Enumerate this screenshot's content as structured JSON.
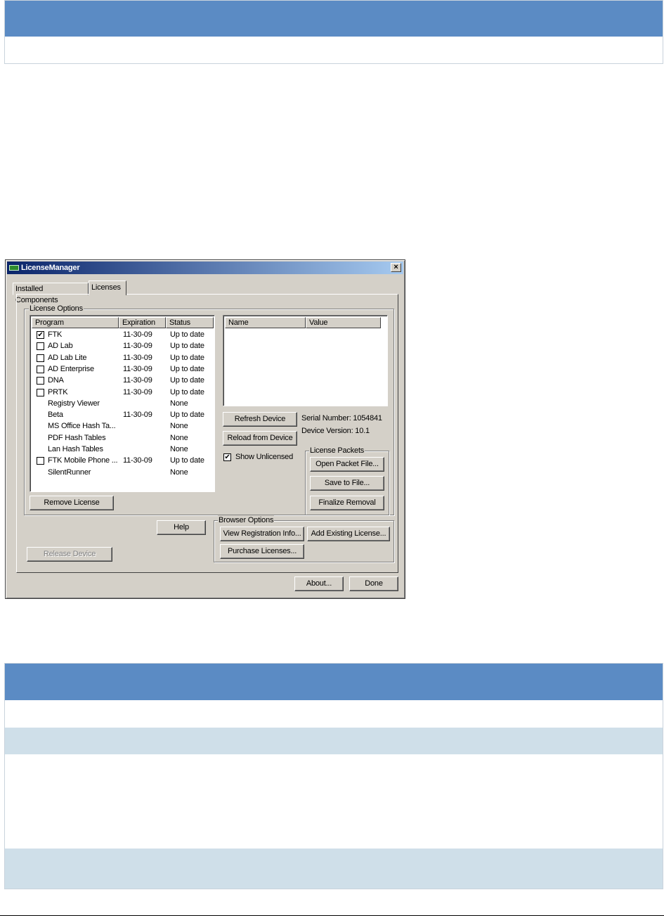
{
  "window": {
    "title": "LicenseManager",
    "close_glyph": "×"
  },
  "tabs": [
    {
      "label": "Installed Components",
      "selected": false
    },
    {
      "label": "Licenses",
      "selected": true
    }
  ],
  "license_options": {
    "group_title": "License Options",
    "columns": [
      "Program",
      "Expiration",
      "Status"
    ],
    "rows": [
      {
        "program": "FTK",
        "expiration": "11-30-09",
        "status": "Up to date",
        "checkbox": true,
        "checked": true
      },
      {
        "program": "AD Lab",
        "expiration": "11-30-09",
        "status": "Up to date",
        "checkbox": true,
        "checked": false
      },
      {
        "program": "AD Lab Lite",
        "expiration": "11-30-09",
        "status": "Up to date",
        "checkbox": true,
        "checked": false
      },
      {
        "program": "AD Enterprise",
        "expiration": "11-30-09",
        "status": "Up to date",
        "checkbox": true,
        "checked": false
      },
      {
        "program": "DNA",
        "expiration": "11-30-09",
        "status": "Up to date",
        "checkbox": true,
        "checked": false
      },
      {
        "program": "PRTK",
        "expiration": "11-30-09",
        "status": "Up to date",
        "checkbox": true,
        "checked": false
      },
      {
        "program": "Registry Viewer",
        "expiration": "",
        "status": "None",
        "checkbox": false,
        "checked": false
      },
      {
        "program": "Beta",
        "expiration": "11-30-09",
        "status": "Up to date",
        "checkbox": false,
        "checked": false
      },
      {
        "program": "MS Office Hash Ta...",
        "expiration": "",
        "status": "None",
        "checkbox": false,
        "checked": false
      },
      {
        "program": "PDF Hash Tables",
        "expiration": "",
        "status": "None",
        "checkbox": false,
        "checked": false
      },
      {
        "program": "Lan Hash Tables",
        "expiration": "",
        "status": "None",
        "checkbox": false,
        "checked": false
      },
      {
        "program": "FTK Mobile Phone ...",
        "expiration": "11-30-09",
        "status": "Up to date",
        "checkbox": true,
        "checked": false
      },
      {
        "program": "SilentRunner",
        "expiration": "",
        "status": "None",
        "checkbox": false,
        "checked": false
      }
    ],
    "remove_license": "Remove License"
  },
  "details": {
    "columns": [
      "Name",
      "Value"
    ],
    "refresh_device": "Refresh Device",
    "reload_from_device": "Reload from Device",
    "serial_number": "Serial Number: 1054841",
    "device_version": "Device Version:  10.1",
    "show_unlicensed": "Show Unlicensed",
    "show_unlicensed_checked": true
  },
  "license_packets": {
    "group_title": "License Packets",
    "open_packet_file": "Open Packet File...",
    "save_to_file": "Save to File...",
    "finalize_removal": "Finalize Removal"
  },
  "help": "Help",
  "release_device": "Release Device",
  "browser_options": {
    "group_title": "Browser Options",
    "view_registration_info": "View Registration Info...",
    "add_existing_license": "Add Existing License...",
    "purchase_licenses": "Purchase Licenses..."
  },
  "footer": {
    "about": "About...",
    "done": "Done"
  },
  "colors": {
    "table_header": "#5b8bc4",
    "table_band": "#cfdfe9",
    "dialog_face": "#d4d0c8",
    "title_start": "#0a246a",
    "title_end": "#a6caf0"
  }
}
